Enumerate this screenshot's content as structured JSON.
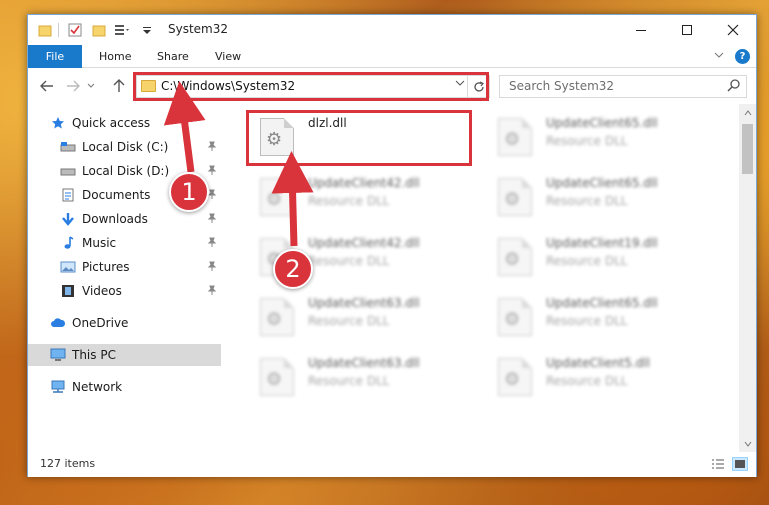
{
  "window": {
    "title": "System32"
  },
  "ribbon": {
    "file": "File",
    "home": "Home",
    "share": "Share",
    "view": "View"
  },
  "navbar": {
    "address": "C:\\Windows\\System32",
    "search_placeholder": "Search System32"
  },
  "sidebar": {
    "items": [
      {
        "label": "Quick access"
      },
      {
        "label": "Local Disk (C:)"
      },
      {
        "label": "Local Disk (D:)"
      },
      {
        "label": "Documents"
      },
      {
        "label": "Downloads"
      },
      {
        "label": "Music"
      },
      {
        "label": "Pictures"
      },
      {
        "label": "Videos"
      },
      {
        "label": "OneDrive"
      },
      {
        "label": "This PC"
      },
      {
        "label": "Network"
      }
    ]
  },
  "files": {
    "highlighted": {
      "name": "dlzl.dll"
    },
    "items": [
      {
        "name": "UpdateClient65.dll",
        "type": "Resource DLL"
      },
      {
        "name": "UpdateClient42.dll",
        "type": "Resource DLL"
      },
      {
        "name": "UpdateClient65.dll",
        "type": "Resource DLL"
      },
      {
        "name": "UpdateClient42.dll",
        "type": "Resource DLL"
      },
      {
        "name": "UpdateClient19.dll",
        "type": "Resource DLL"
      },
      {
        "name": "UpdateClient63.dll",
        "type": "Resource DLL"
      },
      {
        "name": "UpdateClient65.dll",
        "type": "Resource DLL"
      },
      {
        "name": "UpdateClient63.dll",
        "type": "Resource DLL"
      },
      {
        "name": "UpdateClient5.dll",
        "type": "Resource DLL"
      }
    ]
  },
  "status": {
    "count": "127 items"
  },
  "callouts": {
    "one": "1",
    "two": "2"
  },
  "colors": {
    "accent": "#1979ca",
    "highlight": "#d9333b"
  }
}
